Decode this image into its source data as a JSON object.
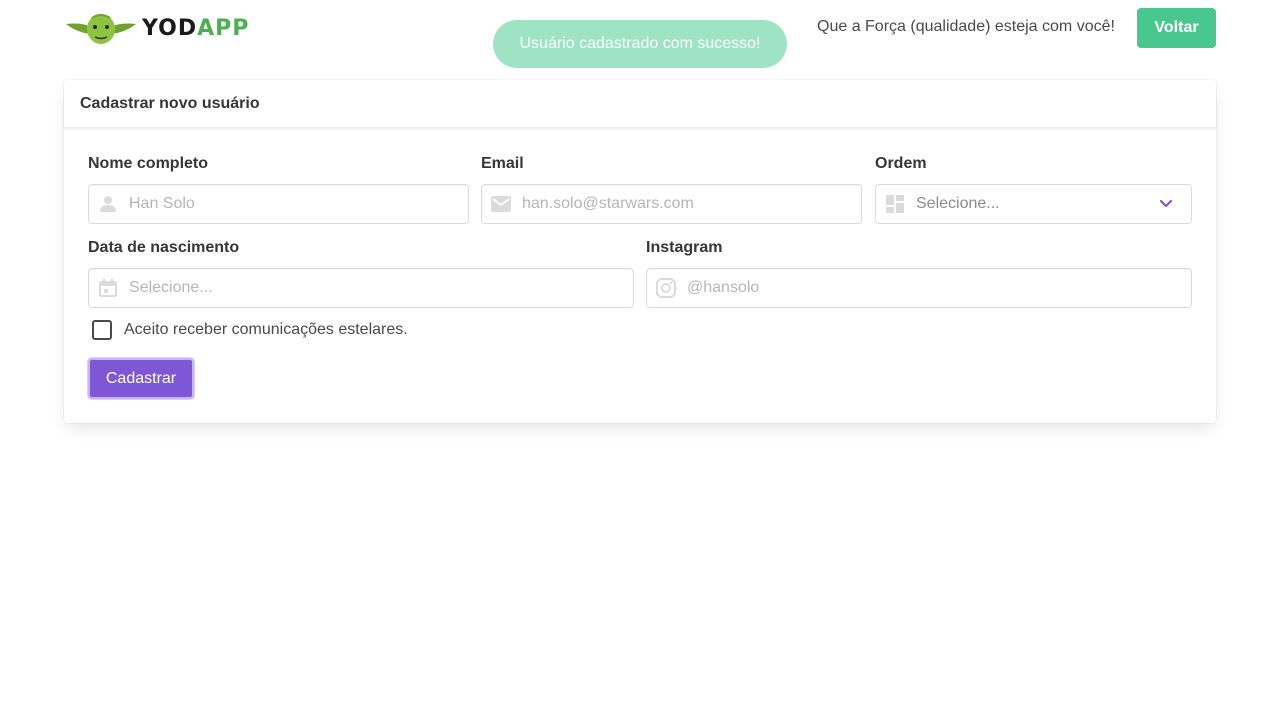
{
  "header": {
    "logo": {
      "part1": "YOD",
      "part2": "APP"
    },
    "tagline": "Que a Força (qualidade) esteja com você!",
    "back_label": "Voltar"
  },
  "toast": {
    "message": "Usuário cadastrado com sucesso!"
  },
  "form": {
    "title": "Cadastrar novo usuário",
    "full_name": {
      "label": "Nome completo",
      "placeholder": "Han Solo",
      "icon": "user-icon"
    },
    "email": {
      "label": "Email",
      "placeholder": "han.solo@starwars.com",
      "icon": "envelope-icon"
    },
    "order": {
      "label": "Ordem",
      "placeholder": "Selecione...",
      "icon": "grid-icon"
    },
    "birth_date": {
      "label": "Data de nascimento",
      "placeholder": "Selecione...",
      "icon": "calendar-icon"
    },
    "instagram": {
      "label": "Instagram",
      "placeholder": "@hansolo",
      "icon": "instagram-icon"
    },
    "consent": {
      "label": "Aceito receber comunicações estelares.",
      "checked": false
    },
    "submit_label": "Cadastrar"
  },
  "colors": {
    "primary": "#7e57d6",
    "success": "#48c78e",
    "toast": "#9ee3c3",
    "logo_green": "#4caf50"
  }
}
